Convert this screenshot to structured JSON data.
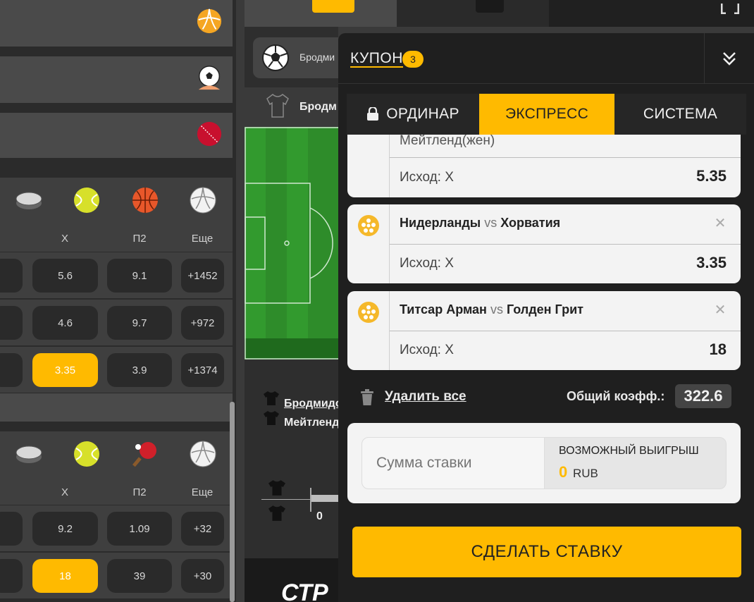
{
  "colors": {
    "accent": "#ffba00",
    "dark": "#1f1f1f"
  },
  "left": {
    "sports_icons_top": [
      "hockey-puck-icon",
      "tennis-ball-icon",
      "basketball-icon",
      "volleyball-icon"
    ],
    "sports_icons_bottom": [
      "hockey-puck-icon",
      "tennis-ball-icon",
      "table-tennis-icon",
      "volleyball-icon"
    ],
    "labels": [
      "X",
      "П2",
      "Еще"
    ],
    "block1_rows": [
      {
        "x": "5.6",
        "p2": "9.1",
        "more": "+1452",
        "selected": false
      },
      {
        "x": "4.6",
        "p2": "9.7",
        "more": "+972",
        "selected": false
      },
      {
        "x": "3.35",
        "p2": "3.9",
        "more": "+1374",
        "selected": true
      }
    ],
    "block2_rows": [
      {
        "x": "9.2",
        "p2": "1.09",
        "more": "+32",
        "selected": false
      },
      {
        "x": "18",
        "p2": "39",
        "more": "+30",
        "selected": true
      }
    ]
  },
  "middle": {
    "team_a": "Бродмидо",
    "team_b": "Мейтленд",
    "chip_label": "Бродми",
    "header_label": "Бродм",
    "score_zero": "0",
    "banner_text": "СТР"
  },
  "coupon": {
    "title": "КУПОН",
    "count": "3",
    "tabs": [
      "ОРДИНАР",
      "ЭКСПРЕСС",
      "СИСТЕМА"
    ],
    "bets": [
      {
        "home": "",
        "away": "",
        "tail": "Мейтленд(жен)",
        "outcome_label": "Исход:",
        "outcome": "X",
        "odd": "5.35"
      },
      {
        "home": "Нидерланды",
        "vs": "vs",
        "away": "Хорватия",
        "outcome_label": "Исход:",
        "outcome": "X",
        "odd": "3.35"
      },
      {
        "home": "Титсар Арман",
        "vs": "vs",
        "away": "Голден Грит",
        "outcome_label": "Исход:",
        "outcome": "X",
        "odd": "18"
      }
    ],
    "delete_all": "Удалить все",
    "total_label": "Общий коэфф.:",
    "total_value": "322.6",
    "stake_placeholder": "Сумма ставки",
    "win_title": "ВОЗМОЖНЫЙ ВЫИГРЫШ",
    "win_amount": "0",
    "currency": "RUB",
    "place_bet": "СДЕЛАТЬ СТАВКУ"
  }
}
